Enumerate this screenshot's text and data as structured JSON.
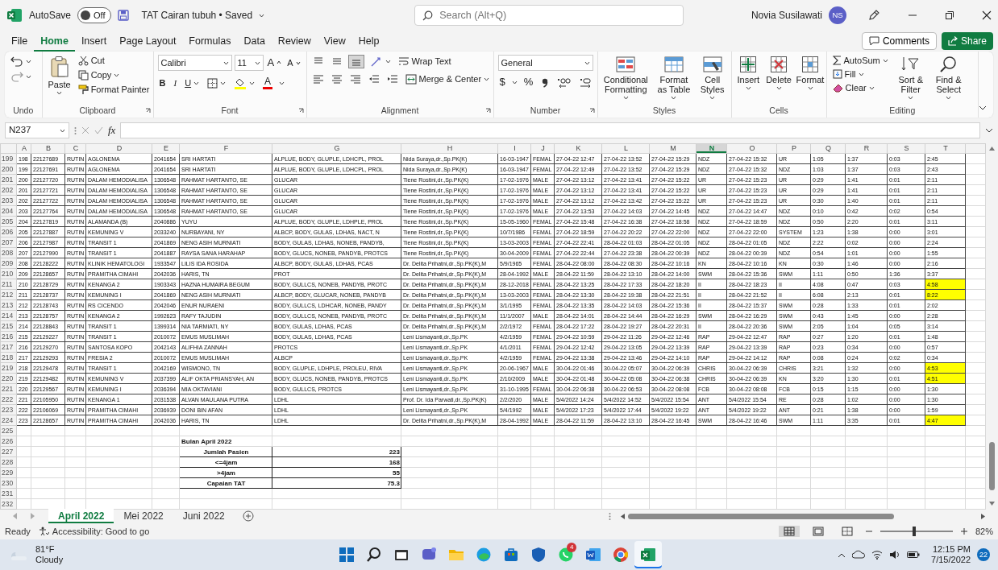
{
  "title_bar": {
    "autosave_label": "AutoSave",
    "autosave": {
      "on": false,
      "label": "Off"
    },
    "document_title": "TAT Cairan tubuh • Saved",
    "search": {
      "placeholder": "Search (Alt+Q)"
    },
    "user_name": "Novia Susilawati",
    "user_initials": "NS"
  },
  "menu_tabs": [
    {
      "label": "File",
      "selected": false
    },
    {
      "label": "Home",
      "selected": true
    },
    {
      "label": "Insert",
      "selected": false
    },
    {
      "label": "Page Layout",
      "selected": false
    },
    {
      "label": "Formulas",
      "selected": false
    },
    {
      "label": "Data",
      "selected": false
    },
    {
      "label": "Review",
      "selected": false
    },
    {
      "label": "View",
      "selected": false
    },
    {
      "label": "Help",
      "selected": false
    }
  ],
  "comments_button": "Comments",
  "share_button": "Share",
  "ribbon": {
    "groups": [
      {
        "kind": "undo",
        "label": "Undo"
      },
      {
        "kind": "clipboard",
        "label": "Clipboard",
        "paste": "Paste",
        "cut": "Cut",
        "copy": "Copy",
        "format_painter": "Format Painter"
      },
      {
        "kind": "font",
        "label": "Font",
        "font_name": "Calibri",
        "font_size": "11",
        "grow": "A",
        "shrink": "A",
        "bold": "B",
        "italic": "I",
        "underline": "U",
        "font_color": "A"
      },
      {
        "kind": "alignment",
        "label": "Alignment",
        "wrap_text": "Wrap Text",
        "merge": "Merge & Center"
      },
      {
        "kind": "number",
        "label": "Number",
        "format": "General",
        "currency": "$",
        "percent": "%"
      },
      {
        "kind": "styles",
        "label": "Styles",
        "buttons": [
          "Conditional Formatting",
          "Format as Table",
          "Cell Styles"
        ]
      },
      {
        "kind": "cells",
        "label": "Cells",
        "buttons": [
          "Insert",
          "Delete",
          "Format"
        ]
      },
      {
        "kind": "editing",
        "label": "Editing",
        "autosum": "AutoSum",
        "fill": "Fill",
        "clear": "Clear",
        "buttons": [
          "Sort & Filter",
          "Find & Select"
        ]
      }
    ]
  },
  "formula_bar": {
    "name_box": "N237",
    "function_label": "fx"
  },
  "grid": {
    "columns": [
      {
        "label": "A",
        "selected": false
      },
      {
        "label": "B",
        "selected": false
      },
      {
        "label": "C",
        "selected": false
      },
      {
        "label": "D",
        "selected": false
      },
      {
        "label": "E",
        "selected": false
      },
      {
        "label": "F",
        "selected": false
      },
      {
        "label": "G",
        "selected": false
      },
      {
        "label": "H",
        "selected": false
      },
      {
        "label": "I",
        "selected": false
      },
      {
        "label": "J",
        "selected": false
      },
      {
        "label": "K",
        "selected": false
      },
      {
        "label": "L",
        "selected": false
      },
      {
        "label": "M",
        "selected": false
      },
      {
        "label": "N",
        "selected": true
      },
      {
        "label": "O",
        "selected": false
      },
      {
        "label": "P",
        "selected": false
      },
      {
        "label": "Q",
        "selected": false
      },
      {
        "label": "R",
        "selected": false
      },
      {
        "label": "S",
        "selected": false
      },
      {
        "label": "T",
        "selected": false
      }
    ],
    "rows": [
      {
        "number": "199",
        "highlighted": false,
        "cells": [
          "198",
          "22127689",
          "RUTIN",
          "AGLONEMA",
          "2041654",
          "SRI HARTATI",
          "ALPLUE, BODY, GLUPLE, LDHCPL, PROL",
          "Nida Suraya,dr.,Sp.PK(K)",
          "16-03-1947",
          "FEMAL",
          "27-04-22 12:47",
          "27-04-22 13:52",
          "27-04-22 15:29",
          "NDZ",
          "27-04-22 15:32",
          "UR",
          "1:05",
          "1:37",
          "0:03",
          "2:45"
        ]
      },
      {
        "number": "200",
        "highlighted": false,
        "cells": [
          "199",
          "22127691",
          "RUTIN",
          "AGLONEMA",
          "2041654",
          "SRI HARTATI",
          "ALPLUE, BODY, GLUPLE, LDHCPL, PROL",
          "Nida Suraya,dr.,Sp.PK(K)",
          "16-03-1947",
          "FEMAL",
          "27-04-22 12:49",
          "27-04-22 13:52",
          "27-04-22 15:29",
          "NDZ",
          "27-04-22 15:32",
          "NDZ",
          "1:03",
          "1:37",
          "0:03",
          "2:43"
        ]
      },
      {
        "number": "201",
        "highlighted": false,
        "cells": [
          "200",
          "22127720",
          "RUTIN",
          "DALAM HEMODIALISA",
          "1306548",
          "RAHMAT HARTANTO, SE",
          "GLUCAR",
          "Tiene Rostini,dr.,Sp.PK(K)",
          "17-02-1976",
          "MALE",
          "27-04-22 13:12",
          "27-04-22 13:41",
          "27-04-22 15:22",
          "UR",
          "27-04-22 15:23",
          "UR",
          "0:29",
          "1:41",
          "0:01",
          "2:11"
        ]
      },
      {
        "number": "202",
        "highlighted": false,
        "cells": [
          "201",
          "22127721",
          "RUTIN",
          "DALAM HEMODIALISA",
          "1306548",
          "RAHMAT HARTANTO, SE",
          "GLUCAR",
          "Tiene Rostini,dr.,Sp.PK(K)",
          "17-02-1976",
          "MALE",
          "27-04-22 13:12",
          "27-04-22 13:41",
          "27-04-22 15:22",
          "UR",
          "27-04-22 15:23",
          "UR",
          "0:29",
          "1:41",
          "0:01",
          "2:11"
        ]
      },
      {
        "number": "203",
        "highlighted": false,
        "cells": [
          "202",
          "22127722",
          "RUTIN",
          "DALAM HEMODIALISA",
          "1306548",
          "RAHMAT HARTANTO, SE",
          "GLUCAR",
          "Tiene Rostini,dr.,Sp.PK(K)",
          "17-02-1976",
          "MALE",
          "27-04-22 13:12",
          "27-04-22 13:42",
          "27-04-22 15:22",
          "UR",
          "27-04-22 15:23",
          "UR",
          "0:30",
          "1:40",
          "0:01",
          "2:11"
        ]
      },
      {
        "number": "204",
        "highlighted": false,
        "cells": [
          "203",
          "22127764",
          "RUTIN",
          "DALAM HEMODIALISA",
          "1306548",
          "RAHMAT HARTANTO, SE",
          "GLUCAR",
          "Tiene Rostini,dr.,Sp.PK(K)",
          "17-02-1976",
          "MALE",
          "27-04-22 13:53",
          "27-04-22 14:03",
          "27-04-22 14:45",
          "NDZ",
          "27-04-22 14:47",
          "NDZ",
          "0:10",
          "0:42",
          "0:02",
          "0:54"
        ]
      },
      {
        "number": "205",
        "highlighted": false,
        "cells": [
          "204",
          "22127819",
          "RUTIN",
          "ALAMANDA (B)",
          "2040886",
          "YUYU",
          "ALPLUE, BODY, GLUPLE, LDHPLE, PROL",
          "Tiene Rostini,dr.,Sp.PK(K)",
          "15-05-1960",
          "FEMAL",
          "27-04-22 15:48",
          "27-04-22 16:38",
          "27-04-22 18:58",
          "NDZ",
          "27-04-22 18:59",
          "NDZ",
          "0:50",
          "2:20",
          "0:01",
          "3:11"
        ]
      },
      {
        "number": "206",
        "highlighted": false,
        "cells": [
          "205",
          "22127887",
          "RUTIN",
          "KEMUNING V",
          "2033240",
          "NURBAYANI, NY",
          "ALBCP, BODY, GULAS, LDHAS, NACT, N",
          "Tiene Rostini,dr.,Sp.PK(K)",
          "10/7/1986",
          "FEMAL",
          "27-04-22 18:59",
          "27-04-22 20:22",
          "27-04-22 22:00",
          "NDZ",
          "27-04-22 22:00",
          "SYSTEM",
          "1:23",
          "1:38",
          "0:00",
          "3:01"
        ]
      },
      {
        "number": "207",
        "highlighted": false,
        "cells": [
          "206",
          "22127987",
          "RUTIN",
          "TRANSIT 1",
          "2041869",
          "NENG ASIH MURNIATI",
          "BODY, GULAS, LDHAS, NONEB, PANDYB,",
          "Tiene Rostini,dr.,Sp.PK(K)",
          "13-03-2003",
          "FEMAL",
          "27-04-22 22:41",
          "28-04-22 01:03",
          "28-04-22 01:05",
          "NDZ",
          "28-04-22 01:05",
          "NDZ",
          "2:22",
          "0:02",
          "0:00",
          "2:24"
        ]
      },
      {
        "number": "208",
        "highlighted": false,
        "cells": [
          "207",
          "22127990",
          "RUTIN",
          "TRANSIT 1",
          "2041887",
          "RAYSA SANA HARAHAP",
          "BODY, GLUCS, NONEB, PANDYB, PROTCS",
          "Tiene Rostini,dr.,Sp.PK(K)",
          "30-04-2009",
          "FEMAL",
          "27-04-22 22:44",
          "27-04-22 23:38",
          "28-04-22 00:39",
          "NDZ",
          "28-04-22 00:39",
          "NDZ",
          "0:54",
          "1:01",
          "0:00",
          "1:55"
        ]
      },
      {
        "number": "209",
        "highlighted": false,
        "cells": [
          "208",
          "22128222",
          "RUTIN",
          "KLINIK HEMATOLOGI",
          "1933547",
          "LILIS IDA ROSIDA",
          "ALBCP, BODY, GULAS, LDHAS, PCAS",
          "Dr. Delita Prihatni,dr.,Sp.PK(K),M",
          "5/9/1965",
          "FEMAL",
          "28-04-22 08:00",
          "28-04-22 08:30",
          "28-04-22 10:16",
          "KN",
          "28-04-22 10:16",
          "KN",
          "0:30",
          "1:46",
          "0:00",
          "2:16"
        ]
      },
      {
        "number": "210",
        "highlighted": false,
        "cells": [
          "209",
          "22128657",
          "RUTIN",
          "PRAMITHA CIMAHI",
          "2042036",
          "HARIS, TN",
          "PROT",
          "Dr. Delita Prihatni,dr.,Sp.PK(K),M",
          "28-04-1992",
          "MALE",
          "28-04-22 11:59",
          "28-04-22 13:10",
          "28-04-22 14:00",
          "SWM",
          "28-04-22 15:36",
          "SWM",
          "1:11",
          "0:50",
          "1:36",
          "3:37"
        ]
      },
      {
        "number": "211",
        "highlighted": true,
        "cells": [
          "210",
          "22128729",
          "RUTIN",
          "KENANGA 2",
          "1903343",
          "HAZNA HUMAIRA BEGUM",
          "BODY, GULLCS, NONEB, PANDYB, PROTC",
          "Dr. Delita Prihatni,dr.,Sp.PK(K),M",
          "28-12-2018",
          "FEMAL",
          "28-04-22 13:25",
          "28-04-22 17:33",
          "28-04-22 18:20",
          "II",
          "28-04-22 18:23",
          "II",
          "4:08",
          "0:47",
          "0:03",
          "4:58"
        ]
      },
      {
        "number": "212",
        "highlighted": true,
        "cells": [
          "211",
          "22128737",
          "RUTIN",
          "KEMUNING I",
          "2041869",
          "NENG ASIH MURNIATI",
          "ALBCP, BODY, GLUCAR, NONEB, PANDYB",
          "Dr. Delita Prihatni,dr.,Sp.PK(K),M",
          "13-03-2003",
          "FEMAL",
          "28-04-22 13:30",
          "28-04-22 19:38",
          "28-04-22 21:51",
          "II",
          "28-04-22 21:52",
          "II",
          "6:08",
          "2:13",
          "0:01",
          "8:22"
        ]
      },
      {
        "number": "213",
        "highlighted": false,
        "cells": [
          "212",
          "22128743",
          "RUTIN",
          "RS CICENDO",
          "2042046",
          "ENUR NURAENI",
          "BODY, GULLCS, LDHCAR, NONEB, PANDY",
          "Dr. Delita Prihatni,dr.,Sp.PK(K),M",
          "3/1/1995",
          "FEMAL",
          "28-04-22 13:35",
          "28-04-22 14:03",
          "28-04-22 15:36",
          "II",
          "28-04-22 15:37",
          "SWM",
          "0:28",
          "1:33",
          "0:01",
          "2:02"
        ]
      },
      {
        "number": "214",
        "highlighted": false,
        "cells": [
          "213",
          "22128757",
          "RUTIN",
          "KENANGA 2",
          "1992623",
          "RAFY TAJUDIN",
          "BODY, GULLCS, NONEB, PANDYB, PROTC",
          "Dr. Delita Prihatni,dr.,Sp.PK(K),M",
          "11/1/2007",
          "MALE",
          "28-04-22 14:01",
          "28-04-22 14:44",
          "28-04-22 16:29",
          "SWM",
          "28-04-22 16:29",
          "SWM",
          "0:43",
          "1:45",
          "0:00",
          "2:28"
        ]
      },
      {
        "number": "215",
        "highlighted": false,
        "cells": [
          "214",
          "22128843",
          "RUTIN",
          "TRANSIT 1",
          "1399314",
          "NIA TARMIATI, NY",
          "BODY, GULAS, LDHAS, PCAS",
          "Dr. Delita Prihatni,dr.,Sp.PK(K),M",
          "2/2/1972",
          "FEMAL",
          "28-04-22 17:22",
          "28-04-22 19:27",
          "28-04-22 20:31",
          "II",
          "28-04-22 20:36",
          "SWM",
          "2:05",
          "1:04",
          "0:05",
          "3:14"
        ]
      },
      {
        "number": "216",
        "highlighted": false,
        "cells": [
          "215",
          "22129227",
          "RUTIN",
          "TRANSIT 1",
          "2010072",
          "EMUS MUSLIMAH",
          "BODY, GULAS, LDHAS, PCAS",
          "Leni Lismayanti,dr.,Sp.PK",
          "4/2/1959",
          "FEMAL",
          "29-04-22 10:59",
          "29-04-22 11:26",
          "29-04-22 12:46",
          "RAP",
          "29-04-22 12:47",
          "RAP",
          "0:27",
          "1:20",
          "0:01",
          "1:48"
        ]
      },
      {
        "number": "217",
        "highlighted": false,
        "cells": [
          "216",
          "22129270",
          "RUTIN",
          "SANTOSA KOPO",
          "2042143",
          "ALIFHIA ZANNAH",
          "PROTCS",
          "Leni Lismayanti,dr.,Sp.PK",
          "4/1/2011",
          "FEMAL",
          "29-04-22 12:42",
          "29-04-22 13:05",
          "29-04-22 13:39",
          "RAP",
          "29-04-22 13:39",
          "RAP",
          "0:23",
          "0:34",
          "0:00",
          "0:57"
        ]
      },
      {
        "number": "218",
        "highlighted": false,
        "cells": [
          "217",
          "22129293",
          "RUTIN",
          "FRESIA 2",
          "2010072",
          "EMUS MUSLIMAH",
          "ALBCP",
          "Leni Lismayanti,dr.,Sp.PK",
          "4/2/1959",
          "FEMAL",
          "29-04-22 13:38",
          "29-04-22 13:46",
          "29-04-22 14:10",
          "RAP",
          "29-04-22 14:12",
          "RAP",
          "0:08",
          "0:24",
          "0:02",
          "0:34"
        ]
      },
      {
        "number": "219",
        "highlighted": true,
        "cells": [
          "218",
          "22129478",
          "RUTIN",
          "TRANSIT 1",
          "2042169",
          "WISMONO, TN",
          "BODY, GLUPLE, LDHPLE, PROLEU, RIVA",
          "Leni Lismayanti,dr.,Sp.PK",
          "20-06-1967",
          "MALE",
          "30-04-22 01:46",
          "30-04-22 05:07",
          "30-04-22 06:39",
          "CHRIS",
          "30-04-22 06:39",
          "CHRIS",
          "3:21",
          "1:32",
          "0:00",
          "4:53"
        ]
      },
      {
        "number": "220",
        "highlighted": true,
        "cells": [
          "219",
          "22129482",
          "RUTIN",
          "KEMUNING V",
          "2037399",
          "ALIF OKTA PRIANSYAH, AN",
          "BODY, GLUCS, NONEB, PANDYB, PROTCS",
          "Leni Lismayanti,dr.,Sp.PK",
          "2/10/2009",
          "MALE",
          "30-04-22 01:48",
          "30-04-22 05:08",
          "30-04-22 06:38",
          "CHRIS",
          "30-04-22 06:39",
          "KN",
          "3:20",
          "1:30",
          "0:01",
          "4:51"
        ]
      },
      {
        "number": "221",
        "highlighted": false,
        "cells": [
          "220",
          "22129567",
          "RUTIN",
          "KEMUNING I",
          "2036394",
          "MIA OKTAVIANI",
          "BODY, GULLCS, PROTCS",
          "Leni Lismayanti,dr.,Sp.PK",
          "31-10-1995",
          "FEMAL",
          "30-04-22 06:38",
          "30-04-22 06:53",
          "30-04-22 08:08",
          "FCB",
          "30-04-22 08:08",
          "FCB",
          "0:15",
          "1:15",
          "0:00",
          "1:30"
        ]
      },
      {
        "number": "222",
        "highlighted": false,
        "cells": [
          "221",
          "22105950",
          "RUTIN",
          "KENANGA 1",
          "2031538",
          "ALVAN MAULANA PUTRA",
          "LDHL",
          "Prof. Dr. Ida Parwati,dr.,Sp.PK(K)",
          "2/2/2020",
          "MALE",
          "5/4/2022 14:24",
          "5/4/2022 14:52",
          "5/4/2022 15:54",
          "ANT",
          "5/4/2022 15:54",
          "RE",
          "0:28",
          "1:02",
          "0:00",
          "1:30"
        ]
      },
      {
        "number": "223",
        "highlighted": false,
        "cells": [
          "222",
          "22106069",
          "RUTIN",
          "PRAMITHA CIMAHI",
          "2036939",
          "DONI BIN AFAN",
          "LDHL",
          "Leni Lismayanti,dr.,Sp.PK",
          "5/4/1992",
          "MALE",
          "5/4/2022 17:23",
          "5/4/2022 17:44",
          "5/4/2022 19:22",
          "ANT",
          "5/4/2022 19:22",
          "ANT",
          "0:21",
          "1:38",
          "0:00",
          "1:59"
        ]
      },
      {
        "number": "224",
        "highlighted": true,
        "cells": [
          "223",
          "22128657",
          "RUTIN",
          "PRAMITHA CIMAHI",
          "2042036",
          "HARIS, TN",
          "LDHL",
          "Dr. Delita Prihatni,dr.,Sp.PK(K),M",
          "28-04-1992",
          "MALE",
          "28-04-22 11:59",
          "28-04-22 13:10",
          "28-04-22 16:45",
          "SWM",
          "28-04-22 16:46",
          "SWM",
          "1:11",
          "3:35",
          "0:01",
          "4:47"
        ]
      },
      {
        "number": "225"
      },
      {
        "number": "226"
      },
      {
        "number": "227"
      },
      {
        "number": "228"
      },
      {
        "number": "229"
      },
      {
        "number": "230"
      },
      {
        "number": "231"
      },
      {
        "number": "232"
      }
    ],
    "summary": {
      "title": "Bulan April 2022",
      "items": [
        {
          "label": "Jumlah Pasien",
          "value": "223"
        },
        {
          "label": "<=4jam",
          "value": "168"
        },
        {
          "label": ">4jam",
          "value": "55"
        },
        {
          "label": "Capaian TAT",
          "value": "75.3"
        }
      ]
    }
  },
  "sheet_tabs": [
    {
      "label": "April 2022",
      "selected": true
    },
    {
      "label": "Mei 2022",
      "selected": false
    },
    {
      "label": "Juni 2022",
      "selected": false
    }
  ],
  "status_bar": {
    "status": "Ready",
    "accessibility": "Accessibility: Good to go",
    "views": [
      {
        "selected": true
      },
      {
        "selected": false
      },
      {
        "selected": false
      }
    ],
    "zoom": {
      "level": 0.47,
      "label": "82%"
    }
  },
  "taskbar": {
    "weather": {
      "temperature": "81°F",
      "condition": "Cloudy"
    },
    "apps": [
      {
        "selected": false
      },
      {
        "selected": false
      },
      {
        "selected": false
      },
      {
        "selected": false
      },
      {
        "selected": false
      },
      {
        "selected": false
      },
      {
        "selected": false
      },
      {
        "selected": false
      },
      {
        "selected": false,
        "badge": "4"
      },
      {
        "selected": false
      },
      {
        "selected": false
      },
      {
        "selected": true
      }
    ],
    "time": "12:15 PM",
    "date": "7/15/2022",
    "notifications": "22"
  }
}
